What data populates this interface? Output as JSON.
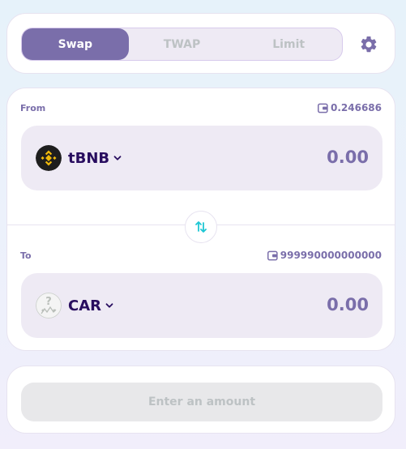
{
  "tabs": [
    {
      "label": "Swap",
      "active": true
    },
    {
      "label": "TWAP",
      "active": false
    },
    {
      "label": "Limit",
      "active": false
    }
  ],
  "settings_icon": "gear-icon",
  "from": {
    "label": "From",
    "balance": "0.246686",
    "token_symbol": "tBNB",
    "amount": "0.00",
    "icon": "bnb-logo"
  },
  "to": {
    "label": "To",
    "balance": "999990000000000",
    "token_symbol": "CAR",
    "amount": "0.00",
    "icon": "unknown-token-logo"
  },
  "switch_icon": "swap-arrows-icon",
  "action": {
    "label": "Enter an amount",
    "disabled": true
  },
  "colors": {
    "accent": "#7a6eaa",
    "text_dark": "#280d5f",
    "switch_arrow": "#1fc7d4",
    "bnb_yellow": "#f0b90b",
    "input_bg": "#eeeaf4",
    "disabled_bg": "#e8e8ea",
    "disabled_text": "#bdc2c4"
  }
}
